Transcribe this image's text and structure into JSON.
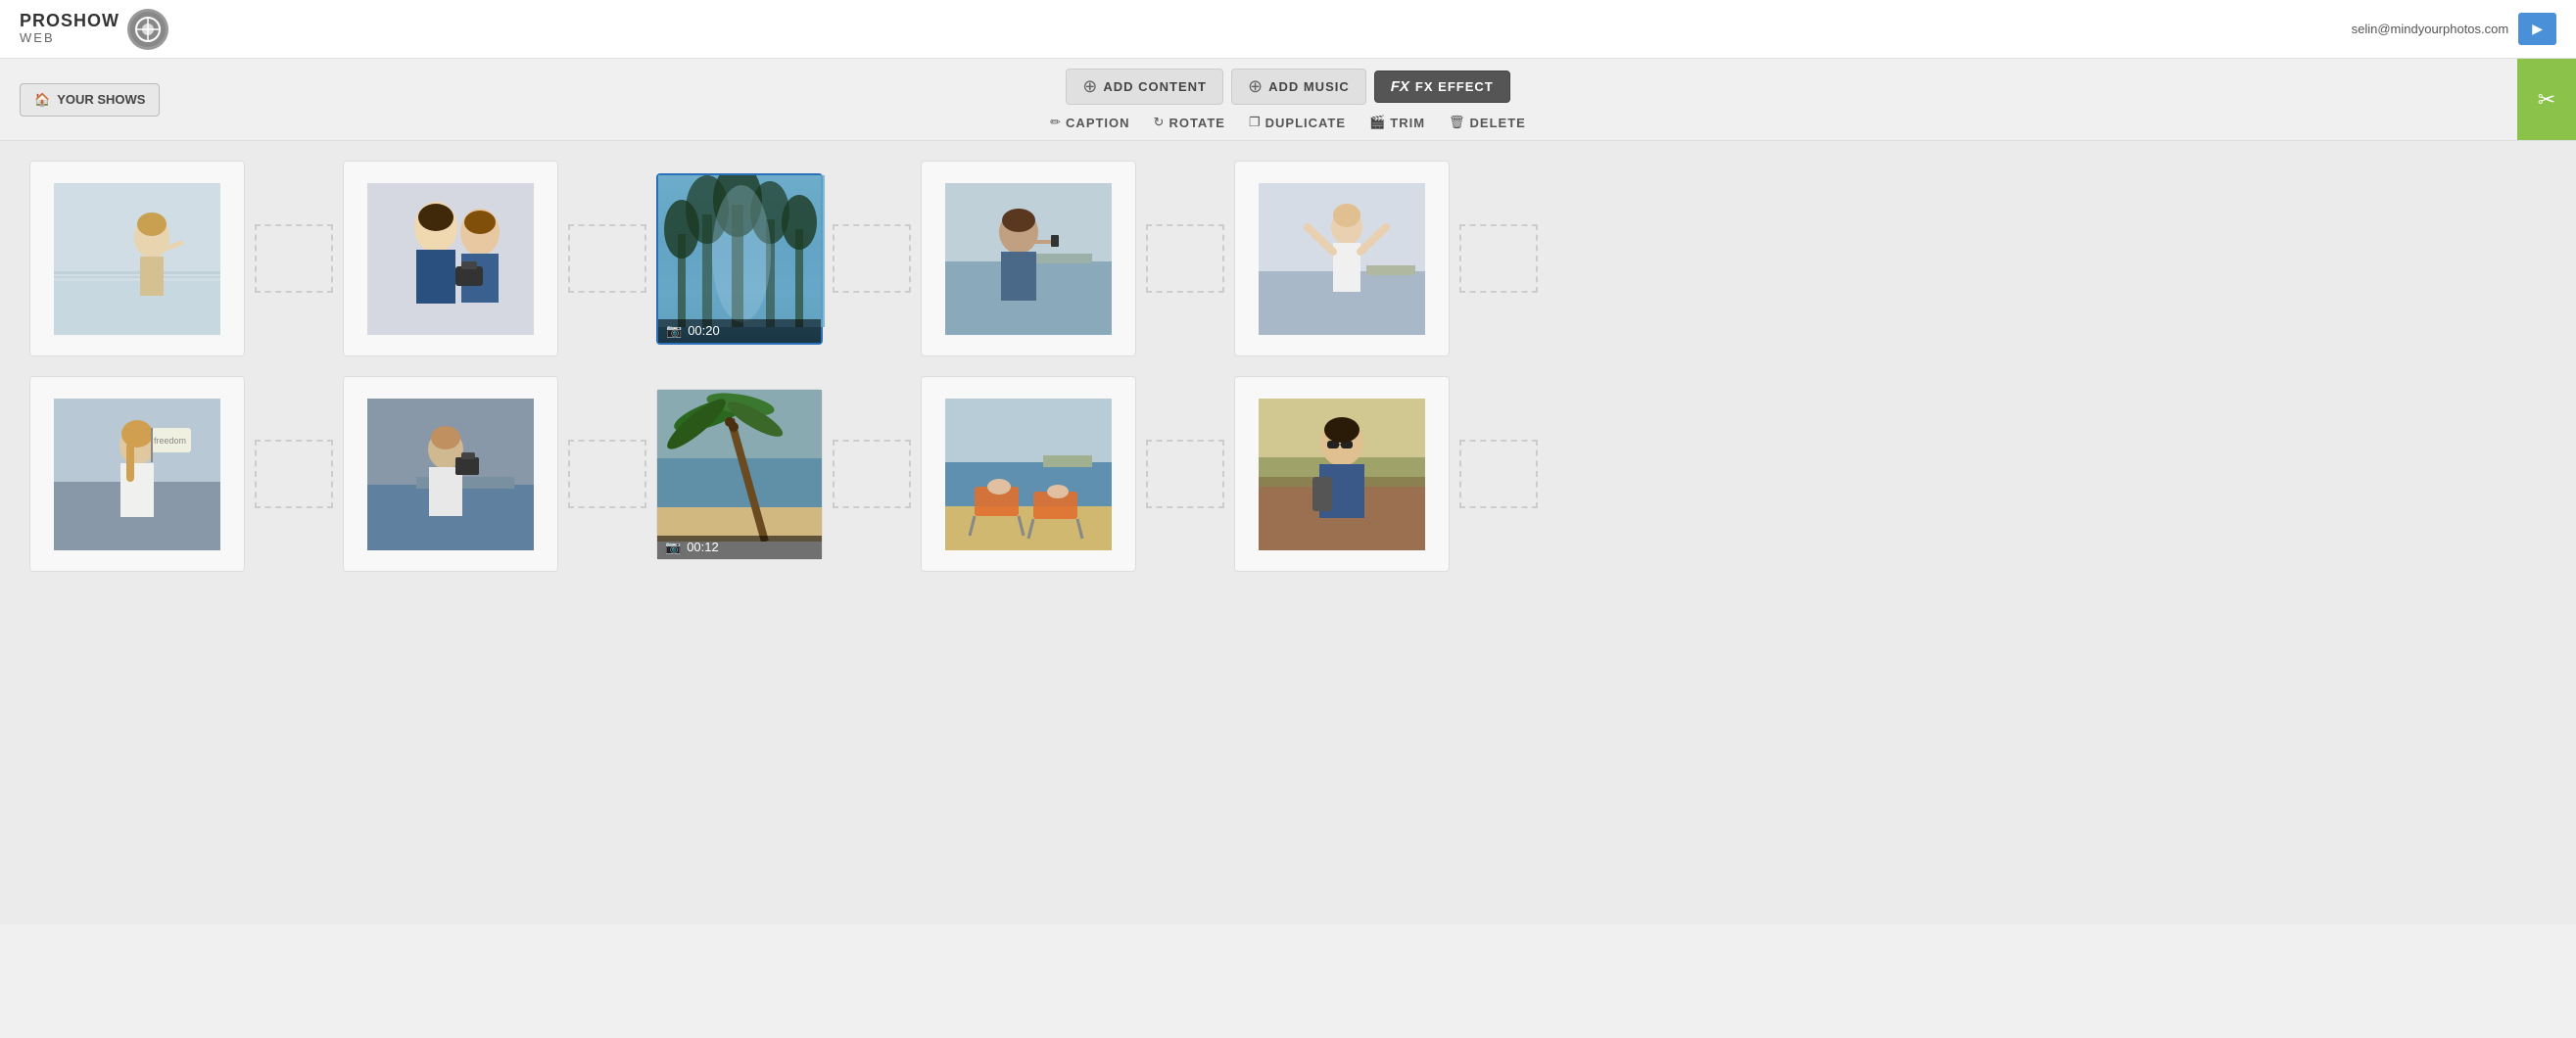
{
  "header": {
    "logo_proshow": "PROSHOW",
    "logo_web": "WEB",
    "user_email": "selin@mindyourphotos.com",
    "publish_icon": "✂"
  },
  "nav": {
    "your_shows_label": "YOUR SHOWS",
    "your_shows_icon": "🏠"
  },
  "toolbar": {
    "add_content_label": "ADD CONTENT",
    "add_music_label": "ADD MUSIC",
    "fx_effect_label": "FX EFFECT",
    "caption_label": "CAPTION",
    "rotate_label": "ROTATE",
    "duplicate_label": "DUPLICATE",
    "trim_label": "TRIM",
    "delete_label": "DELETE"
  },
  "slides": {
    "row1": [
      {
        "type": "photo",
        "color": "#b8c9d8",
        "has_image": true,
        "label": "woman-beach"
      },
      {
        "type": "placeholder"
      },
      {
        "type": "photo",
        "color": "#7a8fa0",
        "has_image": true,
        "label": "two-women-camera"
      },
      {
        "type": "placeholder"
      },
      {
        "type": "video",
        "duration": "00:20",
        "selected": true,
        "label": "forest-video"
      },
      {
        "type": "placeholder"
      },
      {
        "type": "photo",
        "color": "#8090a0",
        "has_image": true,
        "label": "woman-water"
      },
      {
        "type": "placeholder"
      },
      {
        "type": "photo",
        "color": "#c5cdd8",
        "has_image": true,
        "label": "woman-arms-up"
      },
      {
        "type": "placeholder"
      }
    ],
    "row2": [
      {
        "type": "photo",
        "color": "#a8b8c5",
        "has_image": true,
        "label": "woman-freedom"
      },
      {
        "type": "placeholder"
      },
      {
        "type": "photo",
        "color": "#7090a8",
        "has_image": true,
        "label": "woman-camera-water"
      },
      {
        "type": "placeholder"
      },
      {
        "type": "video",
        "duration": "00:12",
        "selected": false,
        "label": "palm-tree-video"
      },
      {
        "type": "placeholder"
      },
      {
        "type": "photo",
        "color": "#c0b090",
        "has_image": true,
        "label": "beach-chairs"
      },
      {
        "type": "placeholder"
      },
      {
        "type": "photo",
        "color": "#a08878",
        "has_image": true,
        "label": "man-camera"
      },
      {
        "type": "placeholder"
      }
    ]
  }
}
